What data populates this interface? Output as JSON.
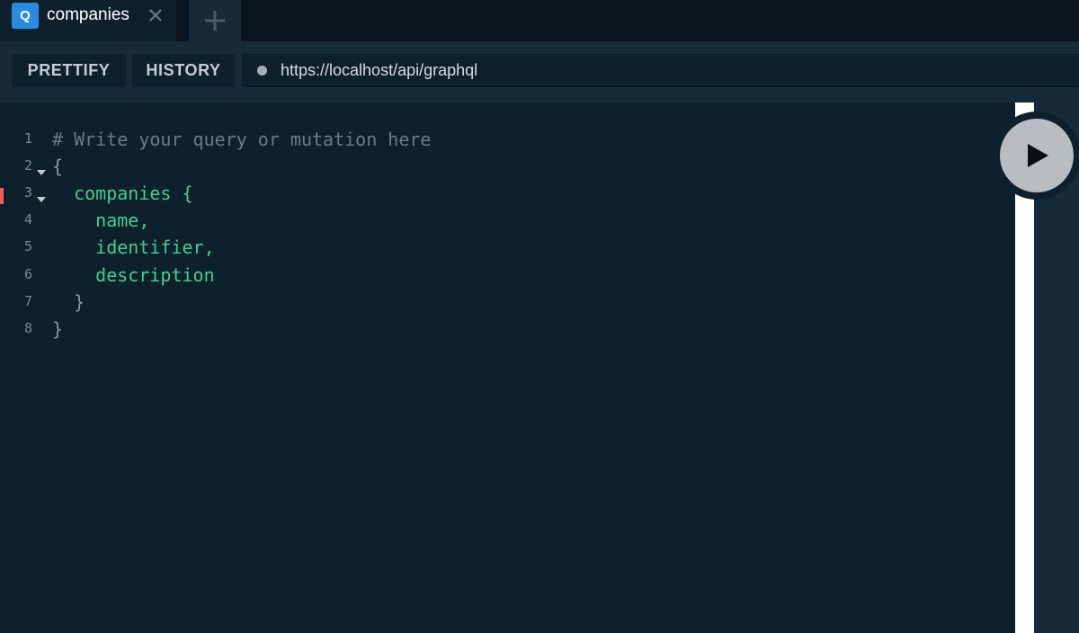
{
  "tab": {
    "badge": "Q",
    "title": "companies"
  },
  "toolbar": {
    "prettify_label": "PRETTIFY",
    "history_label": "HISTORY",
    "endpoint_url": "https://localhost/api/graphql"
  },
  "editor": {
    "lines": [
      {
        "number": "1",
        "text": "# Write your query or mutation here"
      },
      {
        "number": "2",
        "text": "{"
      },
      {
        "number": "3",
        "text": "  companies {"
      },
      {
        "number": "4",
        "text": "    name,"
      },
      {
        "number": "5",
        "text": "    identifier,"
      },
      {
        "number": "6",
        "text": "    description"
      },
      {
        "number": "7",
        "text": "  }"
      },
      {
        "number": "8",
        "text": "}"
      }
    ]
  },
  "colors": {
    "background": "#0f202d",
    "toolbar": "#172a3a",
    "badge": "#2b8be0",
    "field": "#3ecf8e",
    "comment": "#6c7a85",
    "error_marker": "#f25c54"
  },
  "icons": {
    "tab_close": "close-icon",
    "new_tab": "plus-icon",
    "run": "play-icon"
  }
}
